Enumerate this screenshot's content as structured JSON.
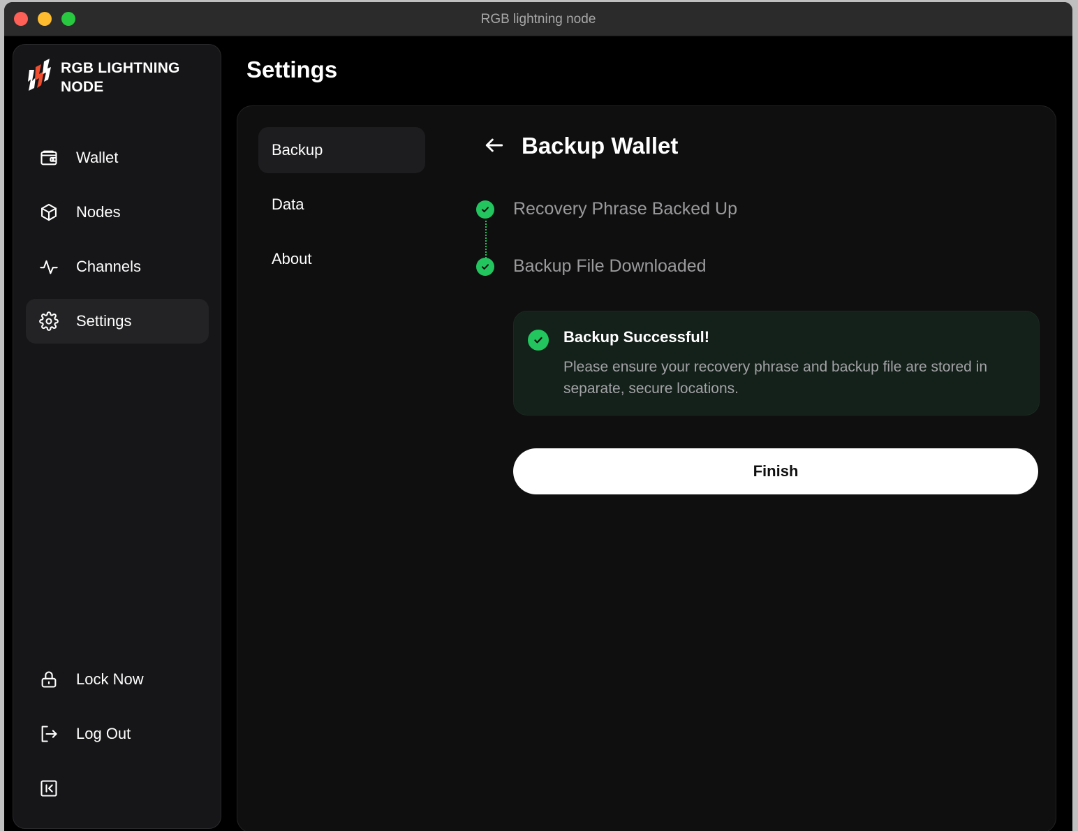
{
  "window": {
    "title": "RGB lightning node"
  },
  "brand": {
    "line1": "RGB LIGHTNING",
    "line2": "NODE",
    "accent_color": "#f04e2f"
  },
  "sidebar": {
    "items": [
      {
        "label": "Wallet",
        "icon": "wallet-icon"
      },
      {
        "label": "Nodes",
        "icon": "cube-icon"
      },
      {
        "label": "Channels",
        "icon": "activity-icon"
      },
      {
        "label": "Settings",
        "icon": "gear-icon",
        "active": true
      }
    ],
    "bottom": [
      {
        "label": "Lock Now",
        "icon": "lock-icon"
      },
      {
        "label": "Log Out",
        "icon": "logout-icon"
      }
    ],
    "collapse_icon": "collapse-sidebar-icon"
  },
  "header": {
    "title": "Settings"
  },
  "settings_nav": {
    "items": [
      {
        "label": "Backup",
        "active": true
      },
      {
        "label": "Data"
      },
      {
        "label": "About"
      }
    ]
  },
  "backup": {
    "title": "Backup Wallet",
    "steps": [
      {
        "label": "Recovery Phrase Backed Up",
        "done": true
      },
      {
        "label": "Backup File Downloaded",
        "done": true
      }
    ],
    "success": {
      "title": "Backup Successful!",
      "message": "Please ensure your recovery phrase and backup file are stored in separate, secure locations."
    },
    "finish_label": "Finish"
  },
  "colors": {
    "success": "#22c55e",
    "background": "#000000",
    "panel": "#0f0f10"
  }
}
